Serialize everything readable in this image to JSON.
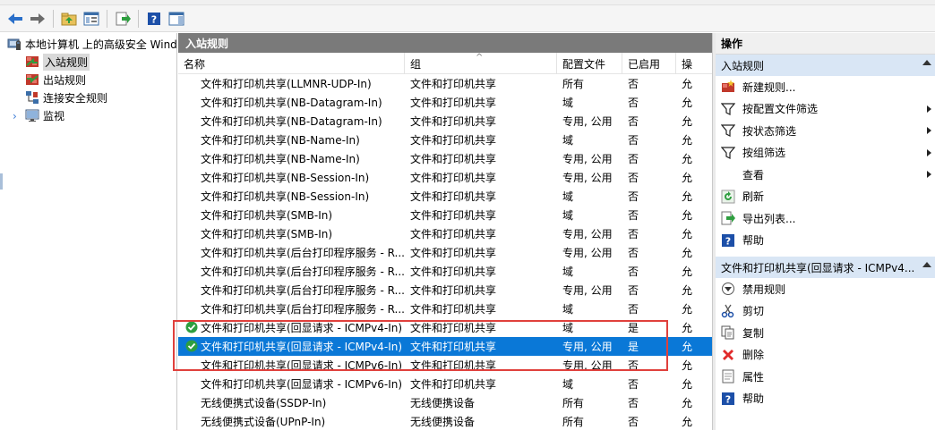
{
  "toolbar": {
    "buttons": [
      "back-arrow-icon",
      "forward-arrow-icon",
      "up-folder-icon",
      "show-hide-tree-icon",
      "export-icon",
      "help-icon",
      "action-pane-icon"
    ]
  },
  "tree": {
    "root_label": "本地计算机 上的高级安全 Wind",
    "items": [
      {
        "label": "入站规则",
        "icon": "inbound-rules-icon",
        "selected": true
      },
      {
        "label": "出站规则",
        "icon": "outbound-rules-icon",
        "selected": false
      },
      {
        "label": "连接安全规则",
        "icon": "connection-security-icon",
        "selected": false
      },
      {
        "label": "监视",
        "icon": "monitoring-icon",
        "selected": false
      }
    ]
  },
  "center": {
    "title": "入站规则",
    "columns": [
      "名称",
      "组",
      "配置文件",
      "已启用",
      "操"
    ],
    "rows": [
      {
        "name": "文件和打印机共享(LLMNR-UDP-In)",
        "group": "文件和打印机共享",
        "profile": "所有",
        "enabled": "否",
        "action": "允",
        "status": "none"
      },
      {
        "name": "文件和打印机共享(NB-Datagram-In)",
        "group": "文件和打印机共享",
        "profile": "域",
        "enabled": "否",
        "action": "允",
        "status": "none"
      },
      {
        "name": "文件和打印机共享(NB-Datagram-In)",
        "group": "文件和打印机共享",
        "profile": "专用, 公用",
        "enabled": "否",
        "action": "允",
        "status": "none"
      },
      {
        "name": "文件和打印机共享(NB-Name-In)",
        "group": "文件和打印机共享",
        "profile": "域",
        "enabled": "否",
        "action": "允",
        "status": "none"
      },
      {
        "name": "文件和打印机共享(NB-Name-In)",
        "group": "文件和打印机共享",
        "profile": "专用, 公用",
        "enabled": "否",
        "action": "允",
        "status": "none"
      },
      {
        "name": "文件和打印机共享(NB-Session-In)",
        "group": "文件和打印机共享",
        "profile": "专用, 公用",
        "enabled": "否",
        "action": "允",
        "status": "none"
      },
      {
        "name": "文件和打印机共享(NB-Session-In)",
        "group": "文件和打印机共享",
        "profile": "域",
        "enabled": "否",
        "action": "允",
        "status": "none"
      },
      {
        "name": "文件和打印机共享(SMB-In)",
        "group": "文件和打印机共享",
        "profile": "域",
        "enabled": "否",
        "action": "允",
        "status": "none"
      },
      {
        "name": "文件和打印机共享(SMB-In)",
        "group": "文件和打印机共享",
        "profile": "专用, 公用",
        "enabled": "否",
        "action": "允",
        "status": "none"
      },
      {
        "name": "文件和打印机共享(后台打印程序服务 - R...",
        "group": "文件和打印机共享",
        "profile": "专用, 公用",
        "enabled": "否",
        "action": "允",
        "status": "none"
      },
      {
        "name": "文件和打印机共享(后台打印程序服务 - R...",
        "group": "文件和打印机共享",
        "profile": "域",
        "enabled": "否",
        "action": "允",
        "status": "none"
      },
      {
        "name": "文件和打印机共享(后台打印程序服务 - R...",
        "group": "文件和打印机共享",
        "profile": "专用, 公用",
        "enabled": "否",
        "action": "允",
        "status": "none"
      },
      {
        "name": "文件和打印机共享(后台打印程序服务 - R...",
        "group": "文件和打印机共享",
        "profile": "域",
        "enabled": "否",
        "action": "允",
        "status": "none"
      },
      {
        "name": "文件和打印机共享(回显请求 - ICMPv4-In)",
        "group": "文件和打印机共享",
        "profile": "域",
        "enabled": "是",
        "action": "允",
        "status": "enabled"
      },
      {
        "name": "文件和打印机共享(回显请求 - ICMPv4-In)",
        "group": "文件和打印机共享",
        "profile": "专用, 公用",
        "enabled": "是",
        "action": "允",
        "status": "enabled",
        "selected": true
      },
      {
        "name": "文件和打印机共享(回显请求 - ICMPv6-In)",
        "group": "文件和打印机共享",
        "profile": "专用, 公用",
        "enabled": "否",
        "action": "允",
        "status": "none"
      },
      {
        "name": "文件和打印机共享(回显请求 - ICMPv6-In)",
        "group": "文件和打印机共享",
        "profile": "域",
        "enabled": "否",
        "action": "允",
        "status": "none"
      },
      {
        "name": "无线便携式设备(SSDP-In)",
        "group": "无线便携设备",
        "profile": "所有",
        "enabled": "否",
        "action": "允",
        "status": "none"
      },
      {
        "name": "无线便携式设备(UPnP-In)",
        "group": "无线便携设备",
        "profile": "所有",
        "enabled": "否",
        "action": "允",
        "status": "none"
      }
    ]
  },
  "actions": {
    "title": "操作",
    "section1": {
      "label": "入站规则",
      "items": [
        {
          "label": "新建规则...",
          "icon": "new-rule-icon",
          "submenu": false
        },
        {
          "label": "按配置文件筛选",
          "icon": "filter-icon",
          "submenu": true
        },
        {
          "label": "按状态筛选",
          "icon": "filter-icon",
          "submenu": true
        },
        {
          "label": "按组筛选",
          "icon": "filter-icon",
          "submenu": true
        },
        {
          "label": "查看",
          "icon": "",
          "submenu": true
        },
        {
          "label": "刷新",
          "icon": "refresh-icon",
          "submenu": false
        },
        {
          "label": "导出列表...",
          "icon": "export-list-icon",
          "submenu": false
        },
        {
          "label": "帮助",
          "icon": "help-icon",
          "submenu": false
        }
      ]
    },
    "section2": {
      "label": "文件和打印机共享(回显请求 - ICMPv4...",
      "items": [
        {
          "label": "禁用规则",
          "icon": "disable-rule-icon"
        },
        {
          "label": "剪切",
          "icon": "cut-icon"
        },
        {
          "label": "复制",
          "icon": "copy-icon"
        },
        {
          "label": "删除",
          "icon": "delete-icon"
        },
        {
          "label": "属性",
          "icon": "properties-icon"
        },
        {
          "label": "帮助",
          "icon": "help-icon"
        }
      ]
    }
  },
  "colors": {
    "selection": "#0a78d7",
    "pane_header": "#7a7a7a",
    "action_section": "#d9e6f5",
    "highlight_box": "#e0403c",
    "enabled_check": "#2e9e3f"
  }
}
